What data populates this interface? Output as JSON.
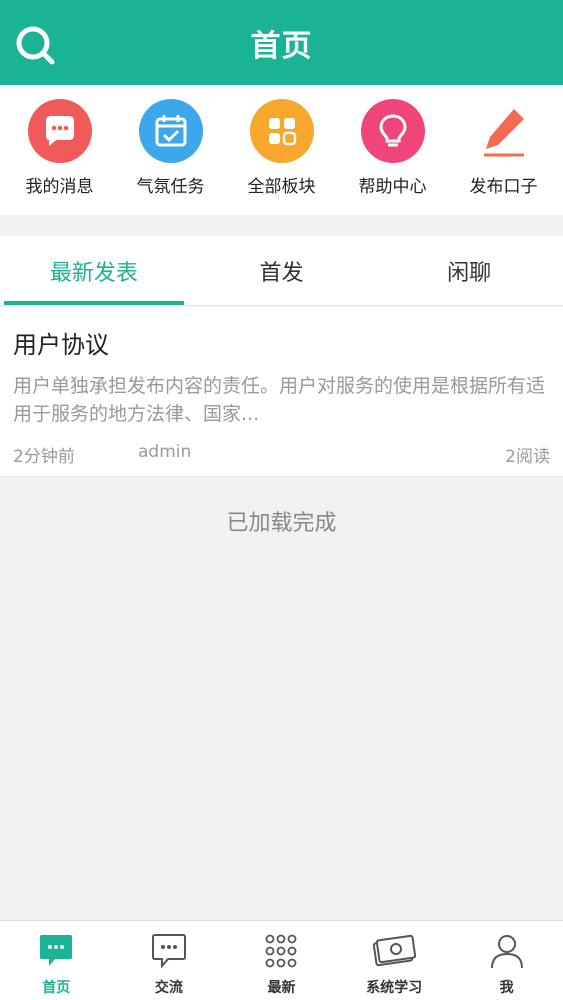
{
  "header": {
    "title": "首页"
  },
  "quick_actions": [
    {
      "label": "我的消息",
      "icon": "chat-bubble-icon",
      "color": "#f05a5a"
    },
    {
      "label": "气氛任务",
      "icon": "calendar-check-icon",
      "color": "#3ca7ea"
    },
    {
      "label": "全部板块",
      "icon": "grid-squares-icon",
      "color": "#f7a72b"
    },
    {
      "label": "帮助中心",
      "icon": "lightbulb-icon",
      "color": "#f0457a"
    },
    {
      "label": "发布口子",
      "icon": "pencil-icon",
      "color": "#f26b4f"
    }
  ],
  "tabs": [
    {
      "label": "最新发表",
      "active": true
    },
    {
      "label": "首发",
      "active": false
    },
    {
      "label": "闲聊",
      "active": false
    }
  ],
  "posts": [
    {
      "title": "用户协议",
      "excerpt": "用户单独承担发布内容的责任。用户对服务的使用是根据所有适用于服务的地方法律、国家...",
      "time": "2分钟前",
      "author": "admin",
      "reads": "2阅读"
    }
  ],
  "status": {
    "loaded_text": "已加载完成"
  },
  "bottom_nav": [
    {
      "label": "首页",
      "icon": "chat-filled-icon",
      "active": true
    },
    {
      "label": "交流",
      "icon": "chat-outline-icon",
      "active": false
    },
    {
      "label": "最新",
      "icon": "dots-grid-icon",
      "active": false
    },
    {
      "label": "系统学习",
      "icon": "money-bill-icon",
      "active": false
    },
    {
      "label": "我",
      "icon": "person-icon",
      "active": false
    }
  ],
  "colors": {
    "accent": "#1ab394"
  }
}
